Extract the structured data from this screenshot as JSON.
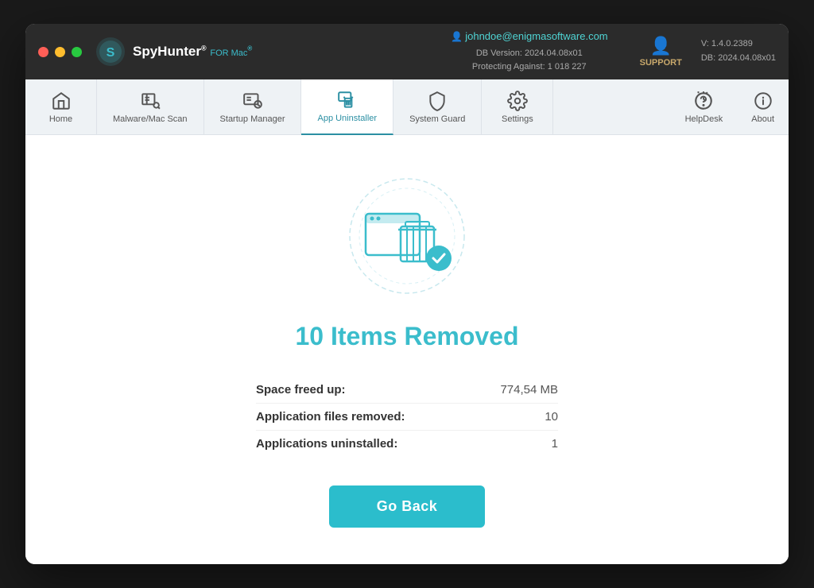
{
  "window": {
    "title": "SpyHunter for Mac"
  },
  "titlebar": {
    "logo_name": "SpyHunter",
    "logo_suffix": "FOR Mac®",
    "user_email": "johndoe@enigmasoftware.com",
    "db_version_label": "DB Version: 2024.04.08x01",
    "protecting_label": "Protecting Against: 1 018 227",
    "support_label": "SUPPORT",
    "version_label": "V: 1.4.0.2389",
    "db_label": "DB:  2024.04.08x01"
  },
  "navbar": {
    "items": [
      {
        "id": "home",
        "label": "Home",
        "icon": "home-icon"
      },
      {
        "id": "malware-scan",
        "label": "Malware/Mac Scan",
        "icon": "scan-icon"
      },
      {
        "id": "startup-manager",
        "label": "Startup Manager",
        "icon": "startup-icon"
      },
      {
        "id": "app-uninstaller",
        "label": "App Uninstaller",
        "icon": "uninstaller-icon",
        "active": true
      },
      {
        "id": "system-guard",
        "label": "System Guard",
        "icon": "shield-icon"
      },
      {
        "id": "settings",
        "label": "Settings",
        "icon": "gear-icon"
      }
    ],
    "right_items": [
      {
        "id": "helpdesk",
        "label": "HelpDesk",
        "icon": "helpdesk-icon"
      },
      {
        "id": "about",
        "label": "About",
        "icon": "info-icon"
      }
    ]
  },
  "main": {
    "result_title": "10 Items Removed",
    "stats": [
      {
        "label": "Space freed up:",
        "value": "774,54 MB"
      },
      {
        "label": "Application files removed:",
        "value": "10"
      },
      {
        "label": "Applications uninstalled:",
        "value": "1"
      }
    ],
    "go_back_label": "Go Back"
  }
}
